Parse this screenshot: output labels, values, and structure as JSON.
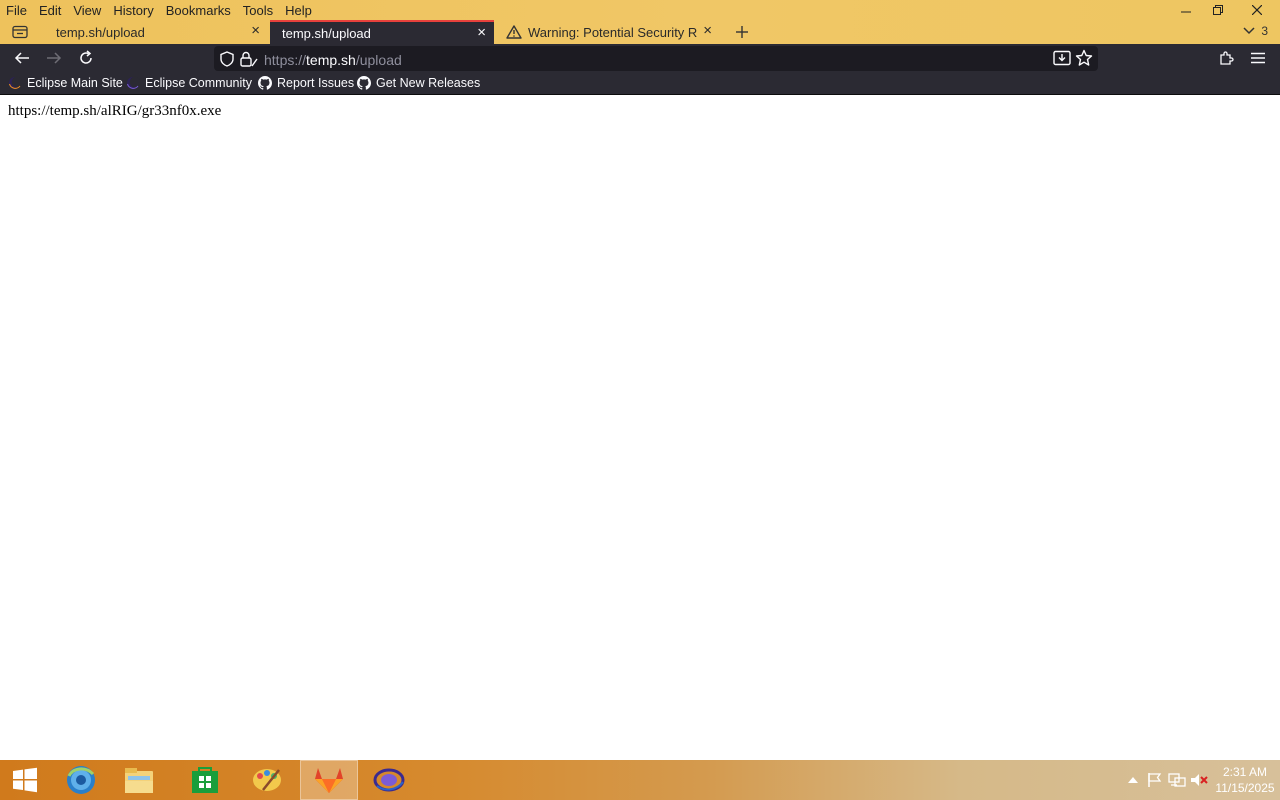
{
  "menu": [
    "File",
    "Edit",
    "View",
    "History",
    "Bookmarks",
    "Tools",
    "Help"
  ],
  "tabs": [
    {
      "title": "temp.sh/upload",
      "active": false
    },
    {
      "title": "temp.sh/upload",
      "active": true
    },
    {
      "title": "Warning: Potential Security Risk",
      "active": false,
      "icon": "warning-icon"
    }
  ],
  "tab_count": "3",
  "urlbar": {
    "scheme": "https://",
    "host": "temp.sh",
    "path": "/upload"
  },
  "bookmarks": [
    {
      "label": "Eclipse Main Site",
      "icon": "eclipse-icon"
    },
    {
      "label": "Eclipse Community",
      "icon": "eclipse-icon"
    },
    {
      "label": "Report Issues",
      "icon": "github-icon"
    },
    {
      "label": "Get New Releases",
      "icon": "github-icon"
    }
  ],
  "page": {
    "text": "https://temp.sh/alRIG/gr33nf0x.exe"
  },
  "taskbar": {
    "apps": [
      "start-icon",
      "browser-icon",
      "file-explorer-icon",
      "store-icon",
      "paint-icon",
      "gitlab-icon",
      "eclipse-app-icon"
    ],
    "time": "2:31 AM",
    "date": "11/15/2025"
  },
  "colors": {
    "tab_active_accent": "#e8413c",
    "toolbar": "#2b2a33",
    "titlebar": "#f0c766"
  }
}
